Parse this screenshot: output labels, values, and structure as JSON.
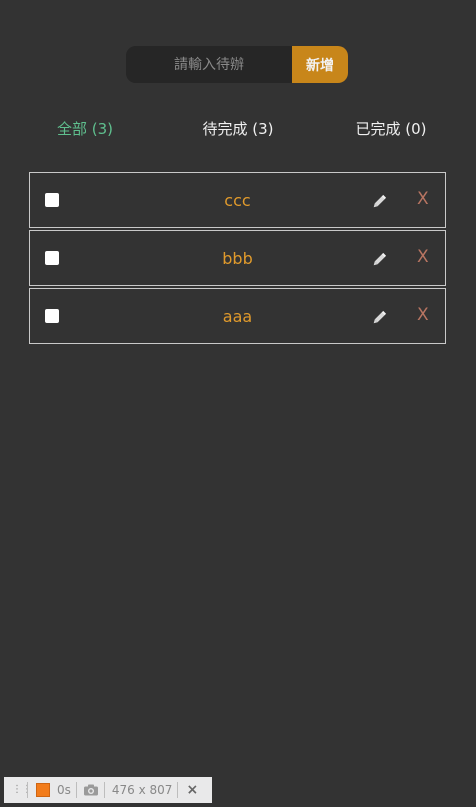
{
  "input": {
    "placeholder": "請輸入待辦",
    "value": ""
  },
  "add_button": {
    "label": "新增"
  },
  "tabs": [
    {
      "label": "全部 (3)",
      "active": true
    },
    {
      "label": "待完成 (3)",
      "active": false
    },
    {
      "label": "已完成 (0)",
      "active": false
    }
  ],
  "items": [
    {
      "text": "ccc",
      "completed": false,
      "delete_label": "X",
      "edit_icon": "pencil-icon"
    },
    {
      "text": "bbb",
      "completed": false,
      "delete_label": "X",
      "edit_icon": "pencil-icon"
    },
    {
      "text": "aaa",
      "completed": false,
      "delete_label": "X",
      "edit_icon": "pencil-icon"
    }
  ],
  "devtools": {
    "grip_icon": "grip-icon",
    "record_icon": "record-icon",
    "time": "0s",
    "camera_icon": "camera-icon",
    "size": "476 x 807",
    "close_label": "×"
  },
  "colors": {
    "background": "#333333",
    "accent": "#c8861a",
    "active_tab": "#5fbf8e",
    "item_text": "#e09a2c",
    "delete": "#b87562"
  }
}
